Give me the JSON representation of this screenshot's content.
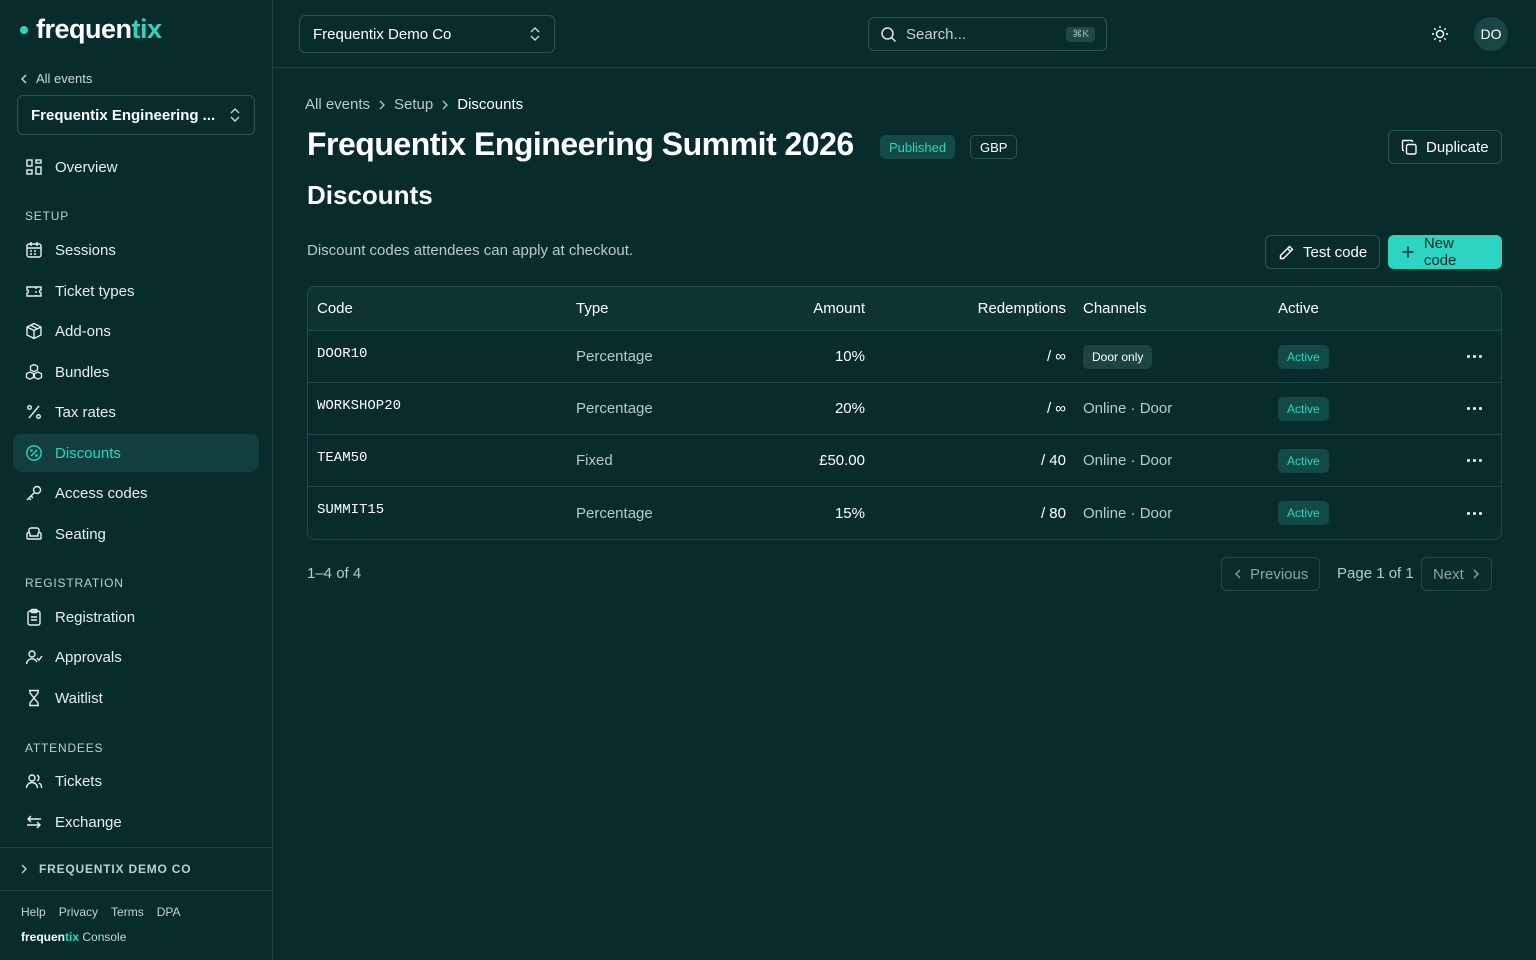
{
  "brand": {
    "name_main": "frequen",
    "name_accent": "tix"
  },
  "sidebar": {
    "back_label": "All events",
    "event_select": "Frequentix Engineering ...",
    "overview": "Overview",
    "sections": [
      {
        "label": "SETUP",
        "items": [
          "Sessions",
          "Ticket types",
          "Add-ons",
          "Bundles",
          "Tax rates",
          "Discounts",
          "Access codes",
          "Seating"
        ]
      },
      {
        "label": "REGISTRATION",
        "items": [
          "Registration",
          "Approvals",
          "Waitlist"
        ]
      },
      {
        "label": "ATTENDEES",
        "items": [
          "Tickets",
          "Exchange"
        ]
      }
    ],
    "active_item": "Discounts",
    "org_row": "FREQUENTIX DEMO CO",
    "footer_links": [
      "Help",
      "Privacy",
      "Terms",
      "DPA"
    ],
    "footer_brand_main": "frequen",
    "footer_brand_accent": "tix",
    "footer_brand_suffix": " Console"
  },
  "topbar": {
    "org_select": "Frequentix Demo Co",
    "search_placeholder": "Search...",
    "search_shortcut": "⌘K",
    "avatar_initials": "DO"
  },
  "main": {
    "breadcrumb": [
      "All events",
      "Setup",
      "Discounts"
    ],
    "title": "Frequentix Engineering Summit 2026",
    "status_badge": "Published",
    "currency_badge": "GBP",
    "duplicate_label": "Duplicate",
    "section_title": "Discounts",
    "section_desc": "Discount codes attendees can apply at checkout.",
    "test_code_label": "Test code",
    "new_code_label": "New code"
  },
  "table": {
    "headers": {
      "code": "Code",
      "type": "Type",
      "amount": "Amount",
      "redemptions": "Redemptions",
      "channels": "Channels",
      "active": "Active"
    },
    "rows": [
      {
        "code": "DOOR10",
        "type": "Percentage",
        "amount": "10%",
        "redemptions": "/ ∞",
        "channels": "Door only",
        "channels_style": "pill",
        "active": "Active"
      },
      {
        "code": "WORKSHOP20",
        "type": "Percentage",
        "amount": "20%",
        "redemptions": "/ ∞",
        "channels": "Online · Door",
        "channels_style": "text",
        "active": "Active"
      },
      {
        "code": "TEAM50",
        "type": "Fixed",
        "amount": "£50.00",
        "redemptions": "/ 40",
        "channels": "Online · Door",
        "channels_style": "text",
        "active": "Active"
      },
      {
        "code": "SUMMIT15",
        "type": "Percentage",
        "amount": "15%",
        "redemptions": "/ 80",
        "channels": "Online · Door",
        "channels_style": "text",
        "active": "Active"
      }
    ]
  },
  "pagination": {
    "count": "1–4 of 4",
    "previous_label": "Previous",
    "page_info": "Page 1 of 1",
    "next_label": "Next"
  },
  "colors": {
    "background": "#082c2c",
    "accent": "#2dd4bf",
    "border": "#1f4c4a"
  }
}
